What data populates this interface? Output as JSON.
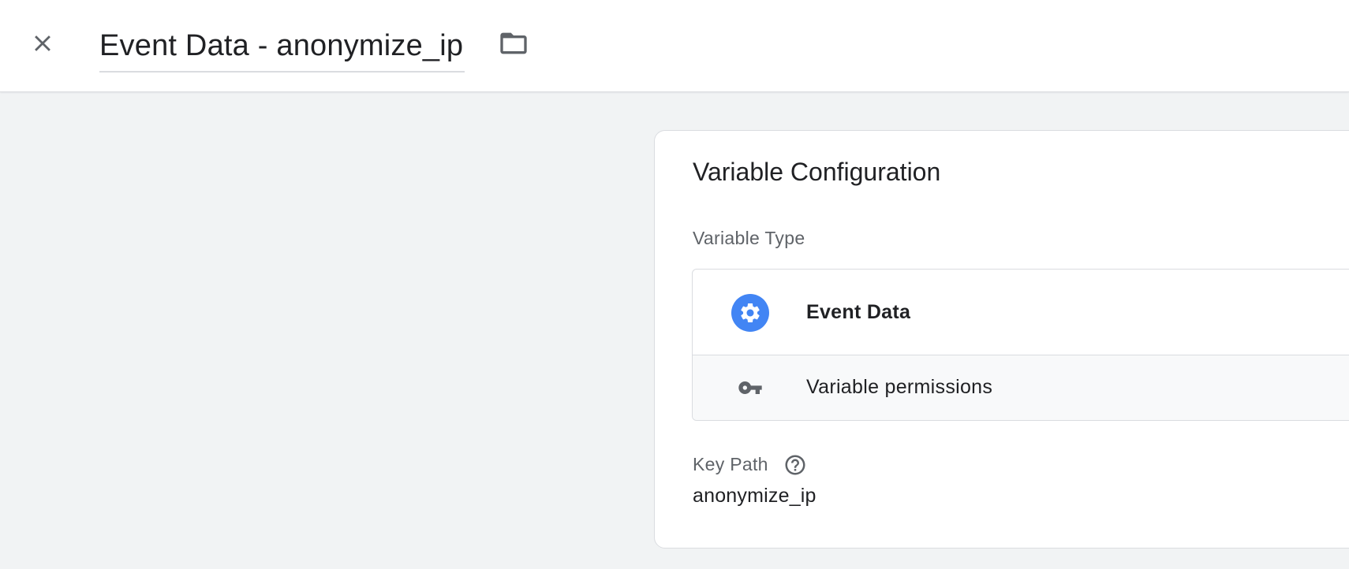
{
  "header": {
    "close_icon": "close-icon",
    "title": "Event Data - anonymize_ip",
    "folder_icon": "folder-icon"
  },
  "card": {
    "title": "Variable Configuration",
    "variable_type_label": "Variable Type",
    "variable_type": {
      "icon": "gear-icon",
      "name": "Event Data",
      "icon_color": "#4285f4"
    },
    "permissions": {
      "icon": "key-icon",
      "label": "Variable permissions"
    },
    "key_path": {
      "label": "Key Path",
      "help_icon": "help-icon",
      "value": "anonymize_ip"
    }
  }
}
